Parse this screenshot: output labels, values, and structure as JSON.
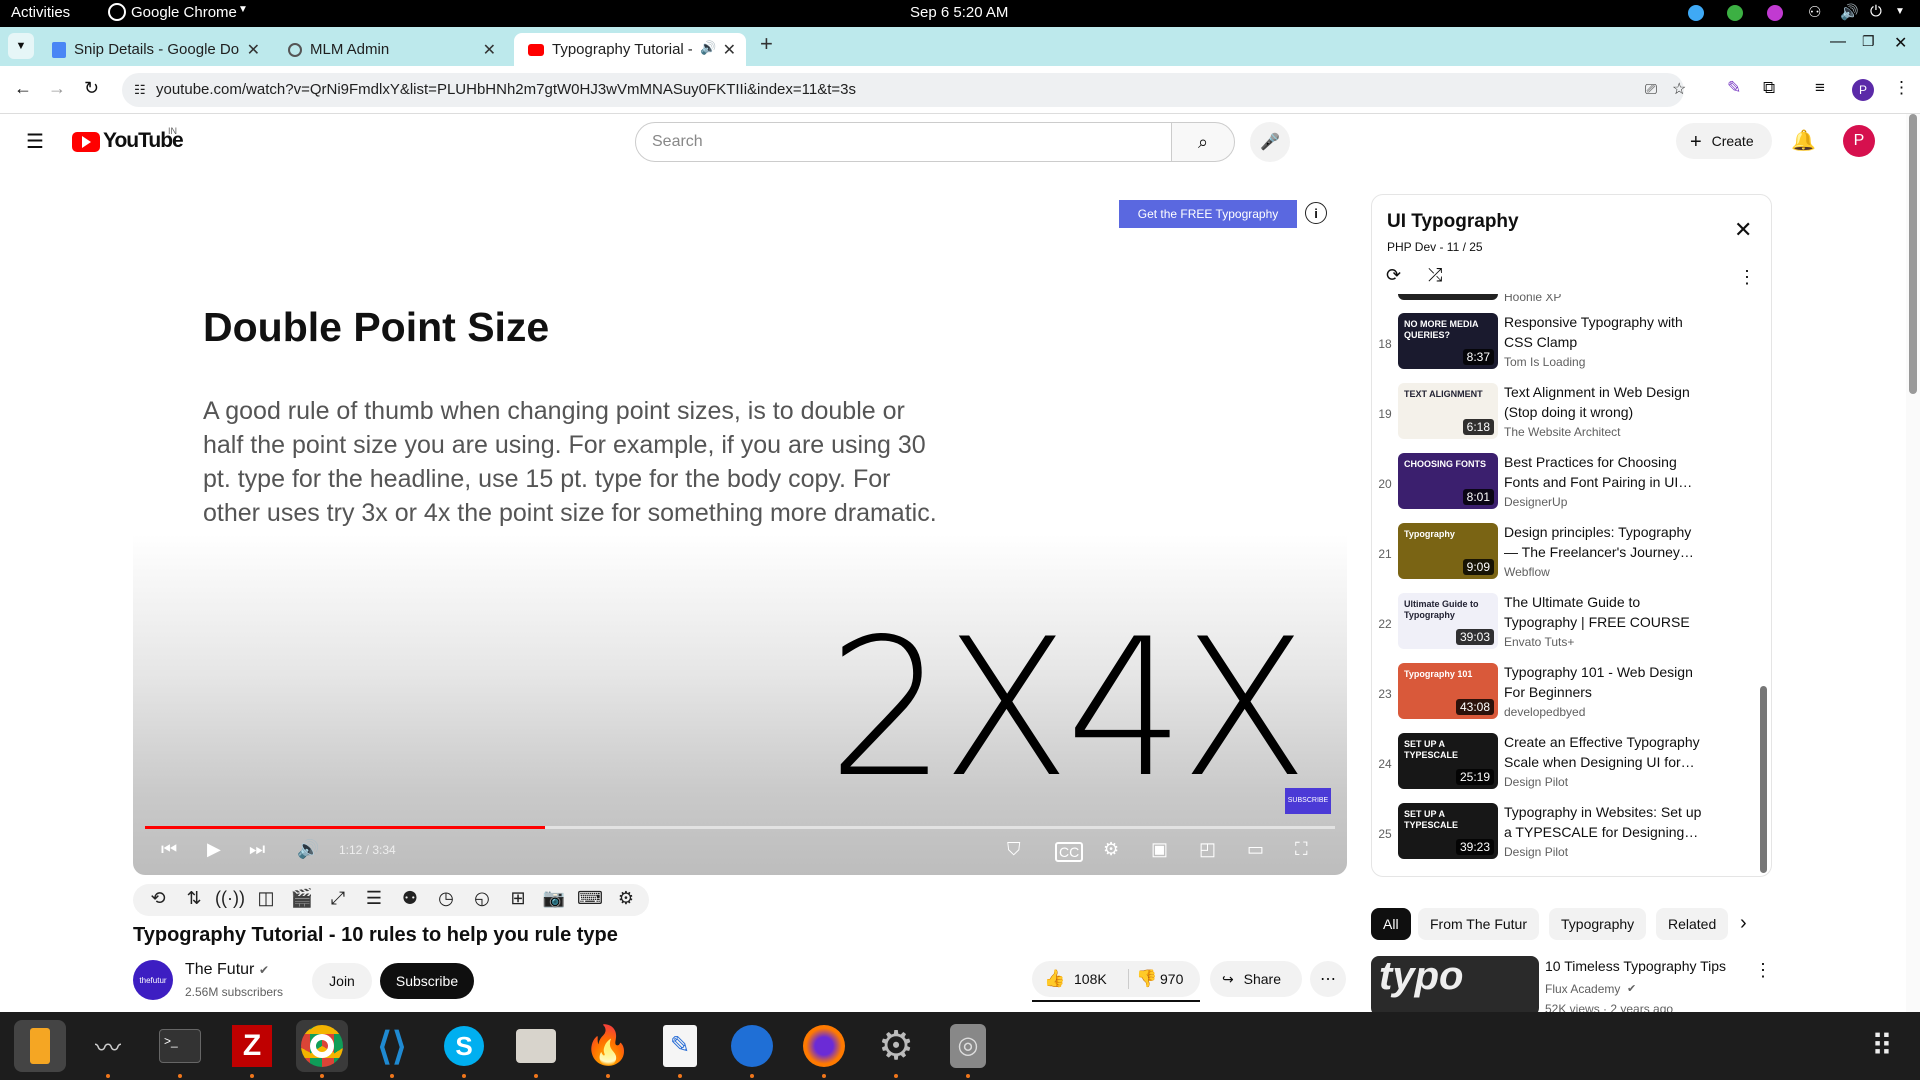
{
  "system_bar": {
    "activities": "Activities",
    "app": "Google Chrome",
    "datetime": "Sep 6  5:20 AM"
  },
  "tabs": [
    {
      "title": "Snip Details - Google Do",
      "icon": "docs-icon"
    },
    {
      "title": "MLM Admin",
      "icon": "globe-icon"
    },
    {
      "title": "Typography Tutorial -",
      "icon": "youtube-icon",
      "active": true
    }
  ],
  "address": {
    "url": "youtube.com/watch?v=QrNi9FmdlxY&list=PLUHbHNh2m7gtW0HJ3wVmMNASuy0FKTIIi&index=11&t=3s",
    "avatar": "P"
  },
  "youtube": {
    "logo": "YouTube",
    "region": "IN",
    "search_placeholder": "Search",
    "create": "Create",
    "avatar": "P"
  },
  "video": {
    "slide_heading": "Double Point Size",
    "slide_body": "A good rule of thumb when changing point sizes, is to double or half the point size you are using. For example, if you are using 30 pt. type for the headline, use 15 pt. type for the body copy. For other uses try 3x or 4x the point size for something more dramatic.",
    "big_text": "2X4X",
    "promo": "Get the FREE Typography Manual",
    "subscribe_badge": "SUBSCRIBE",
    "time": "1:12 / 3:34",
    "progress": 0.3362,
    "title": "Typography Tutorial - 10 rules to help you rule type",
    "channel": "The Futur",
    "channel_avatar": "thefutur",
    "subscribers": "2.56M subscribers",
    "join": "Join",
    "subscribe": "Subscribe",
    "likes": "108K",
    "dislikes": "970",
    "share": "Share"
  },
  "playlist": {
    "title": "UI Typography",
    "meta": "PHP Dev - 11 / 25",
    "partial_channel": "Hoonie XP",
    "items": [
      {
        "n": "18",
        "title": "Responsive Typography with CSS Clamp",
        "channel": "Tom Is Loading",
        "duration": "8:37",
        "thumb_text": "NO MORE MEDIA QUERIES?",
        "color": "#1a1a2e"
      },
      {
        "n": "19",
        "title": "Text Alignment in Web Design (Stop doing it wrong)",
        "channel": "The Website Architect",
        "duration": "6:18",
        "thumb_text": "TEXT ALIGNMENT",
        "color": "#f4f1ea"
      },
      {
        "n": "20",
        "title": "Best Practices for Choosing Fonts and Font Pairing in UI…",
        "channel": "DesignerUp",
        "duration": "8:01",
        "thumb_text": "CHOOSING FONTS",
        "color": "#3b1f6e"
      },
      {
        "n": "21",
        "title": "Design principles: Typography — The Freelancer's Journey…",
        "channel": "Webflow",
        "duration": "9:09",
        "thumb_text": "Typography",
        "color": "#7a6414"
      },
      {
        "n": "22",
        "title": "The Ultimate Guide to Typography | FREE COURSE",
        "channel": "Envato Tuts+",
        "duration": "39:03",
        "thumb_text": "Ultimate Guide to Typography",
        "color": "#f0f0f8"
      },
      {
        "n": "23",
        "title": "Typography 101 - Web Design For Beginners",
        "channel": "developedbyed",
        "duration": "43:08",
        "thumb_text": "Typography 101",
        "color": "#d9593a"
      },
      {
        "n": "24",
        "title": "Create an Effective Typography Scale when Designing UI for…",
        "channel": "Design Pilot",
        "duration": "25:19",
        "thumb_text": "SET UP A TYPESCALE",
        "color": "#171717"
      },
      {
        "n": "25",
        "title": "Typography in Websites: Set up a TYPESCALE for Designing…",
        "channel": "Design Pilot",
        "duration": "39:23",
        "thumb_text": "SET UP A TYPESCALE",
        "color": "#171717"
      }
    ]
  },
  "chips": [
    "All",
    "From The Futur",
    "Typography",
    "Related"
  ],
  "related": {
    "title": "10 Timeless Typography Tips",
    "channel": "Flux Academy",
    "meta": "52K views · 2 years ago",
    "thumb_text": "typo"
  }
}
